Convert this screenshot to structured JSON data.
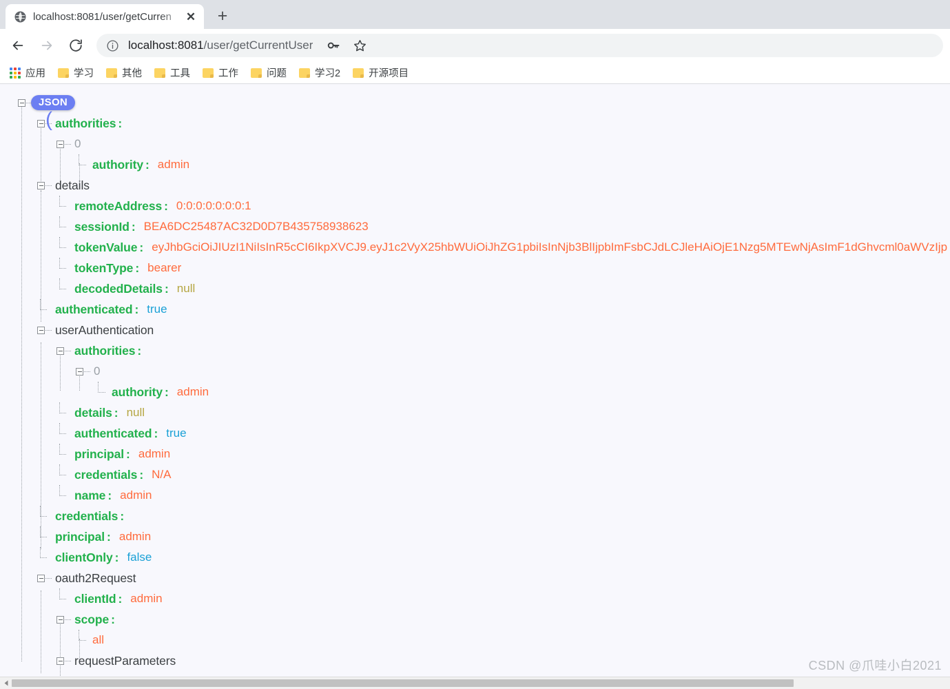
{
  "browser": {
    "tab": {
      "title": "localhost:8081/user/getCurren",
      "favicon": "globe-icon",
      "close_label": "✕"
    },
    "new_tab_label": "+",
    "nav": {
      "back": "back-arrow-icon",
      "forward": "forward-arrow-icon",
      "reload": "reload-icon"
    },
    "omnibox": {
      "info_icon": "info-circle-icon",
      "url_host": "localhost:8081",
      "url_path": "/user/getCurrentUser",
      "full_url": "localhost:8081/user/getCurrentUser"
    },
    "omni_actions": [
      {
        "name": "key-icon",
        "label": ""
      },
      {
        "name": "bookmark-star-icon",
        "label": ""
      }
    ],
    "bookmarks": [
      {
        "label": "应用",
        "icon": "apps-grid-icon"
      },
      {
        "label": "学习",
        "icon": "folder-icon"
      },
      {
        "label": "其他",
        "icon": "folder-icon"
      },
      {
        "label": "工具",
        "icon": "folder-icon"
      },
      {
        "label": "工作",
        "icon": "folder-icon"
      },
      {
        "label": "问题",
        "icon": "folder-icon"
      },
      {
        "label": "学习2",
        "icon": "folder-icon"
      },
      {
        "label": "开源项目",
        "icon": "folder-icon"
      }
    ]
  },
  "viewer": {
    "root_badge": "JSON",
    "colon": ":",
    "watermark": "CSDN @爪哇小白2021"
  },
  "json": {
    "authorities_key": "authorities",
    "authorities_index": "0",
    "authority_key": "authority",
    "authority_value": "admin",
    "details_key": "details",
    "remoteAddress_key": "remoteAddress",
    "remoteAddress_value": "0:0:0:0:0:0:0:1",
    "sessionId_key": "sessionId",
    "sessionId_value": "BEA6DC25487AC32D0D7B435758938623",
    "tokenValue_key": "tokenValue",
    "tokenValue_value": "eyJhbGciOiJIUzI1NiIsInR5cCI6IkpXVCJ9.eyJ1c2VyX25hbWUiOiJhZG1pbiIsInNjb3BlIjpbImFsbCJdLCJleHAiOjE1Nzg5MTEwNjAsImF1dGhvcml0aWVzIjp",
    "tokenType_key": "tokenType",
    "tokenType_value": "bearer",
    "decodedDetails_key": "decodedDetails",
    "decodedDetails_value": "null",
    "authenticated_key": "authenticated",
    "authenticated_value": "true",
    "userAuthentication_key": "userAuthentication",
    "ua_authorities_key": "authorities",
    "ua_authorities_index": "0",
    "ua_authority_key": "authority",
    "ua_authority_value": "admin",
    "ua_details_key": "details",
    "ua_details_value": "null",
    "ua_authenticated_key": "authenticated",
    "ua_authenticated_value": "true",
    "ua_principal_key": "principal",
    "ua_principal_value": "admin",
    "ua_credentials_key": "credentials",
    "ua_credentials_value": "N/A",
    "ua_name_key": "name",
    "ua_name_value": "admin",
    "credentials_key": "credentials",
    "principal_key": "principal",
    "principal_value": "admin",
    "clientOnly_key": "clientOnly",
    "clientOnly_value": "false",
    "oauth2Request_key": "oauth2Request",
    "clientId_key": "clientId",
    "clientId_value": "admin",
    "scope_key": "scope",
    "scope_value": "all",
    "requestParameters_key": "requestParameters"
  },
  "colors": {
    "key_green": "#22b14c",
    "value_orange": "#ff6b3d",
    "value_bool_blue": "#1ba1d6",
    "value_null_olive": "#b5a642",
    "badge_blue": "#6c7ff2",
    "page_bg": "#f8f8fd",
    "tabstrip_bg": "#dee1e6",
    "folder_yellow": "#fcd462"
  }
}
